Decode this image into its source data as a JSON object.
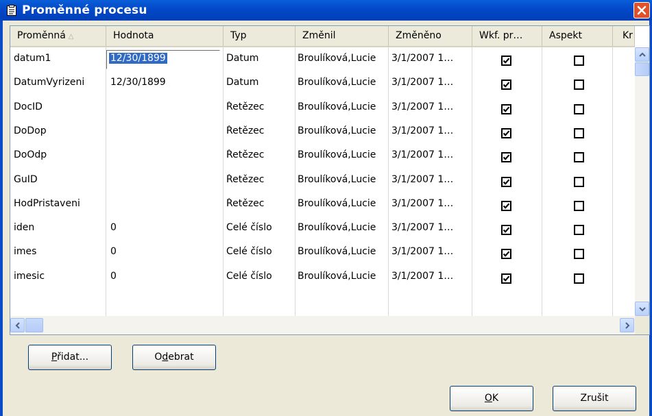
{
  "window": {
    "title": "Proměnné procesu"
  },
  "columns": [
    {
      "label": "Proměnná"
    },
    {
      "label": "Hodnota"
    },
    {
      "label": "Typ"
    },
    {
      "label": "Změnil"
    },
    {
      "label": "Změněno"
    },
    {
      "label": "Wkf. pr…"
    },
    {
      "label": "Aspekt"
    },
    {
      "label": "Kr"
    }
  ],
  "rows": [
    {
      "name": "datum1",
      "value": "12/30/1899",
      "type": "Datum",
      "changed_by": "Broulíková,Lucie",
      "changed": "3/1/2007 1…",
      "wkf": true,
      "aspect": false
    },
    {
      "name": "DatumVyrizeni",
      "value": "12/30/1899",
      "type": "Datum",
      "changed_by": "Broulíková,Lucie",
      "changed": "3/1/2007 1…",
      "wkf": true,
      "aspect": false
    },
    {
      "name": "DocID",
      "value": "",
      "type": "Řetězec",
      "changed_by": "Broulíková,Lucie",
      "changed": "3/1/2007 1…",
      "wkf": true,
      "aspect": false
    },
    {
      "name": "DoDop",
      "value": "",
      "type": "Řetězec",
      "changed_by": "Broulíková,Lucie",
      "changed": "3/1/2007 1…",
      "wkf": true,
      "aspect": false
    },
    {
      "name": "DoOdp",
      "value": "",
      "type": "Řetězec",
      "changed_by": "Broulíková,Lucie",
      "changed": "3/1/2007 1…",
      "wkf": true,
      "aspect": false
    },
    {
      "name": "GuID",
      "value": "",
      "type": "Řetězec",
      "changed_by": "Broulíková,Lucie",
      "changed": "3/1/2007 1…",
      "wkf": true,
      "aspect": false
    },
    {
      "name": "HodPristaveni",
      "value": "",
      "type": "Řetězec",
      "changed_by": "Broulíková,Lucie",
      "changed": "3/1/2007 1…",
      "wkf": true,
      "aspect": false
    },
    {
      "name": "iden",
      "value": "0",
      "type": "Celé číslo",
      "changed_by": "Broulíková,Lucie",
      "changed": "3/1/2007 1…",
      "wkf": true,
      "aspect": false
    },
    {
      "name": "imes",
      "value": "0",
      "type": "Celé číslo",
      "changed_by": "Broulíková,Lucie",
      "changed": "3/1/2007 1…",
      "wkf": true,
      "aspect": false
    },
    {
      "name": "imesic",
      "value": "0",
      "type": "Celé číslo",
      "changed_by": "Broulíková,Lucie",
      "changed": "3/1/2007 1…",
      "wkf": true,
      "aspect": false
    }
  ],
  "buttons": {
    "add": {
      "hotkey": "P",
      "rest": "řidat..."
    },
    "remove": {
      "pre": "O",
      "hotkey": "d",
      "rest": "ebrat"
    },
    "ok": {
      "hotkey": "O",
      "rest": "K"
    },
    "cancel": {
      "label": "Zrušit"
    }
  },
  "icons": {
    "title": "clipboard-icon",
    "close": "close-icon",
    "check": "checkmark-icon"
  },
  "colors": {
    "titlebar": "#0248C8",
    "selection": "#316AC5",
    "close": "#E0502B",
    "dialog": "#ECE9D8"
  }
}
